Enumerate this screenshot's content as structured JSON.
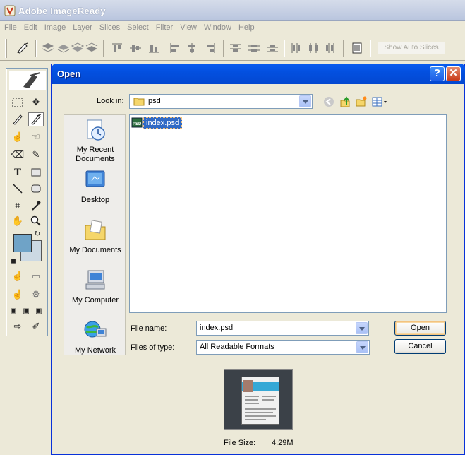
{
  "app": {
    "title": "Adobe ImageReady",
    "menu": [
      "File",
      "Edit",
      "Image",
      "Layer",
      "Slices",
      "Select",
      "Filter",
      "View",
      "Window",
      "Help"
    ],
    "show_auto_slices": "Show Auto Slices"
  },
  "dialog": {
    "title": "Open",
    "help_glyph": "?",
    "close_glyph": "✕",
    "look_in_label": "Look in:",
    "look_in_value": "psd",
    "places": [
      {
        "label": "My Recent Documents"
      },
      {
        "label": "Desktop"
      },
      {
        "label": "My Documents"
      },
      {
        "label": "My Computer"
      },
      {
        "label": "My Network"
      }
    ],
    "files": [
      {
        "name": "index.psd",
        "icon_text": "PSD"
      }
    ],
    "file_name_label": "File name:",
    "file_name_value": "index.psd",
    "files_of_type_label": "Files of type:",
    "files_of_type_value": "All Readable Formats",
    "open_button": "Open",
    "cancel_button": "Cancel",
    "file_size_label": "File Size:",
    "file_size_value": "4.29M"
  },
  "colors": {
    "title_bar_blue": "#0350e0",
    "selection_blue": "#316ac5",
    "foreground_color": "#6fa3c7",
    "background_color": "#ccd9e3"
  }
}
